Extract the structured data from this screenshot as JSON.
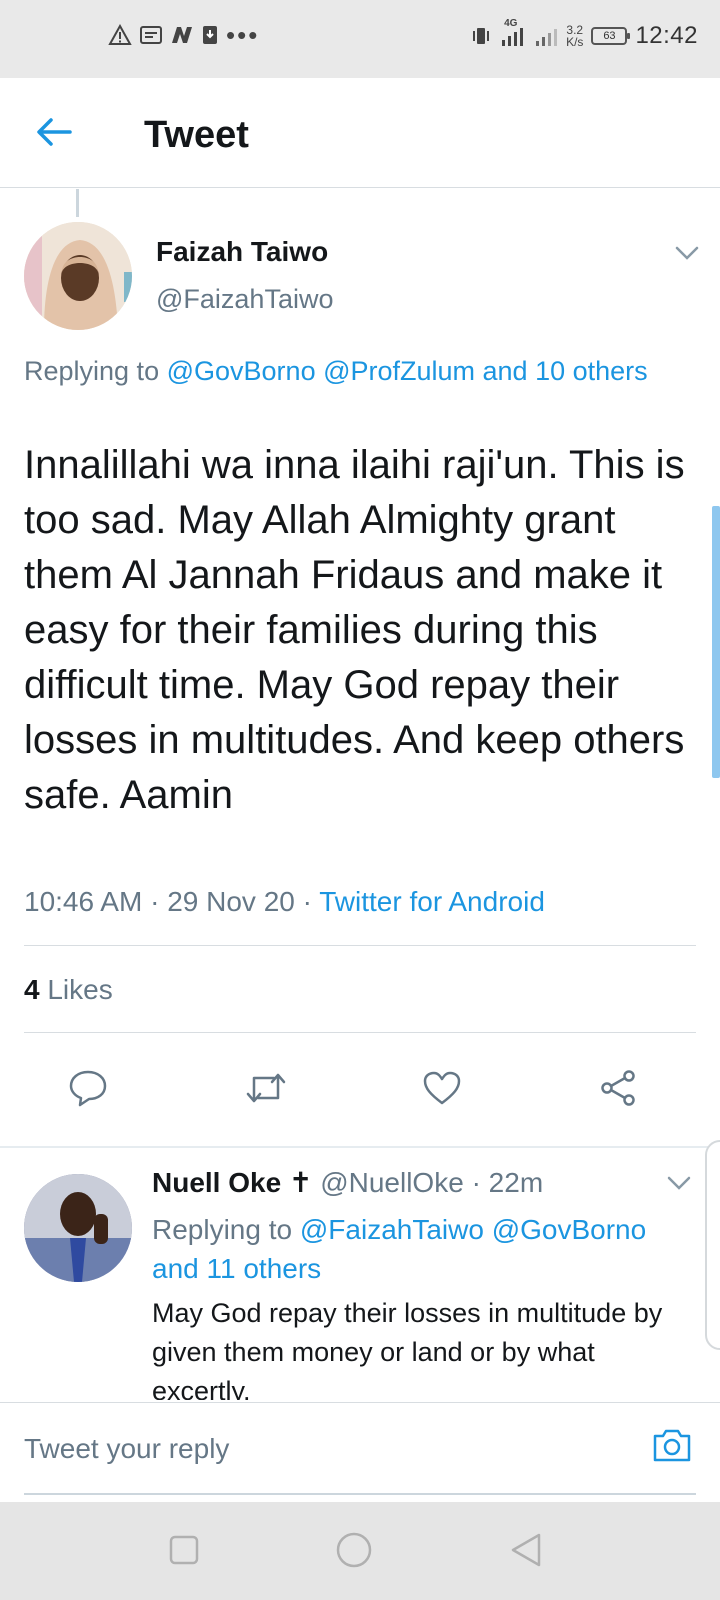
{
  "status_bar": {
    "time": "12:42",
    "network_type": "4G",
    "net_speed_value": "3.2",
    "net_speed_unit": "K/s",
    "battery_level": "63",
    "notification_icons": [
      "warning-icon",
      "message-icon",
      "n-app-icon",
      "download-icon",
      "more-dots-icon"
    ],
    "more_dots": "•••"
  },
  "header": {
    "title": "Tweet",
    "back_icon": "arrow-left-icon"
  },
  "tweet": {
    "author_name": "Faizah Taiwo",
    "author_handle": "@FaizahTaiwo",
    "replying_prefix": "Replying to",
    "replying_to": "@GovBorno @ProfZulum and 10 others",
    "text": "Innalillahi wa inna ilaihi raji'un. This is too sad. May Allah Almighty grant them Al Jannah Fridaus and make it easy for their families during this difficult time. May God repay their losses in multitudes. And keep others safe. Aamin",
    "time": "10:46 AM",
    "date": "29 Nov 20",
    "separator": "·",
    "source": "Twitter for Android",
    "likes_count": "4",
    "likes_label": "Likes",
    "actions": [
      "reply-icon",
      "retweet-icon",
      "like-icon",
      "share-icon"
    ]
  },
  "reply": {
    "author_name": "Nuell Oke ✝",
    "author_handle": "@NuellOke",
    "separator": "·",
    "time_ago": "22m",
    "replying_prefix": "Replying to",
    "replying_to": "@FaizahTaiwo @GovBorno and 11 others",
    "text": "May God repay their losses in multitude by given them money or land or by what excertly."
  },
  "compose": {
    "placeholder": "Tweet your reply",
    "camera_icon": "camera-icon"
  },
  "nav_bar": {
    "buttons": [
      "recents-square-icon",
      "home-circle-icon",
      "back-triangle-icon"
    ]
  },
  "colors": {
    "accent": "#1b95e0",
    "text_primary": "#14171a",
    "text_secondary": "#657786",
    "divider": "#d8dde1",
    "status_bar_bg": "#e9e9e9",
    "nav_bar_bg": "#e5e5e5"
  }
}
